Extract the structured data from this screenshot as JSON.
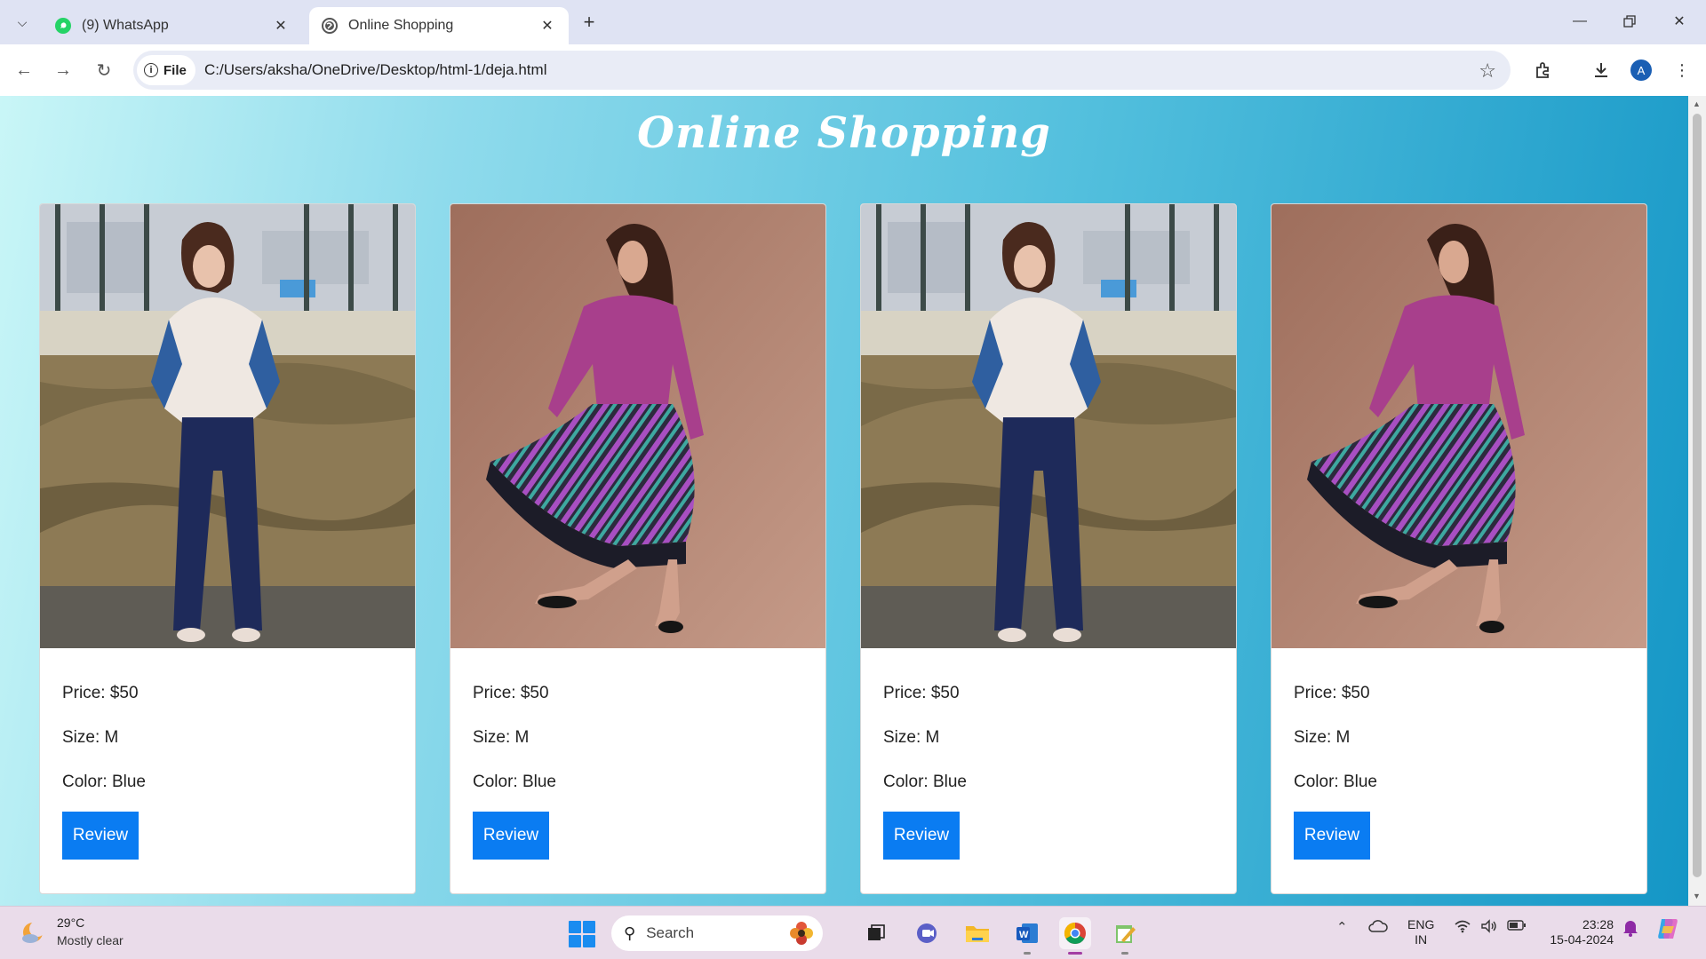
{
  "browser": {
    "tabs": [
      {
        "title": "(9) WhatsApp",
        "active": false,
        "favicon": "whatsapp-icon"
      },
      {
        "title": "Online Shopping",
        "active": true,
        "favicon": "globe-icon"
      }
    ],
    "omnibox": {
      "scheme_chip": "File",
      "url": "C:/Users/aksha/OneDrive/Desktop/html-1/deja.html"
    },
    "profile_initial": "A"
  },
  "page": {
    "title": "Online Shopping",
    "products": [
      {
        "price": "Price: $50",
        "size": "Size: M",
        "color": "Color: Blue",
        "button": "Review",
        "photo": "woman-denim-jacket-photo"
      },
      {
        "price": "Price: $50",
        "size": "Size: M",
        "color": "Color: Blue",
        "button": "Review",
        "photo": "woman-striped-skirt-photo"
      },
      {
        "price": "Price: $50",
        "size": "Size: M",
        "color": "Color: Blue",
        "button": "Review",
        "photo": "woman-denim-jacket-photo"
      },
      {
        "price": "Price: $50",
        "size": "Size: M",
        "color": "Color: Blue",
        "button": "Review",
        "photo": "woman-striped-skirt-photo"
      }
    ]
  },
  "taskbar": {
    "weather": {
      "temp": "29°C",
      "desc": "Mostly clear"
    },
    "search_placeholder": "Search",
    "language": {
      "line1": "ENG",
      "line2": "IN"
    },
    "clock": {
      "time": "23:28",
      "date": "15-04-2024"
    }
  },
  "colors": {
    "accent_button": "#0a7cf2",
    "page_gradient_start": "#c9f6f7",
    "page_gradient_end": "#1496c6"
  }
}
